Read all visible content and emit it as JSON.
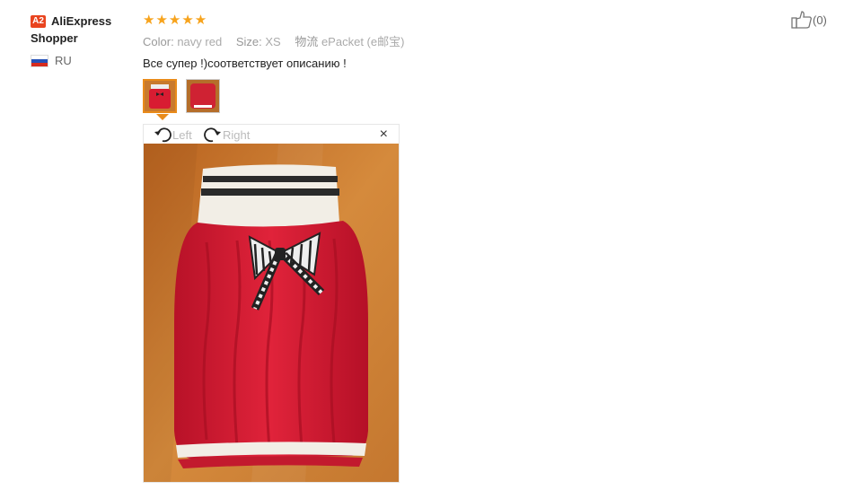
{
  "reviewer": {
    "badge": "A2",
    "name": "AliExpress Shopper",
    "country": "RU"
  },
  "review": {
    "stars": "★★★★★",
    "rating": 5,
    "attributes": [
      {
        "key": "Color:",
        "value": "navy red"
      },
      {
        "key": "Size:",
        "value": "XS"
      },
      {
        "key": "物流",
        "value": "ePacket (e邮宝)"
      }
    ],
    "text": "Все супер !)соответствует описанию !"
  },
  "viewer": {
    "rotate_left_label": "Left",
    "rotate_right_label": "Right",
    "close_label": "×"
  },
  "helpful": {
    "count": "(0)"
  },
  "colors": {
    "badge": "#e9441f",
    "stars": "#f7a31c",
    "active_thumb_border": "#e98b1a",
    "sweater_red": "#d81c32",
    "wood_background": "#c87a2e"
  }
}
